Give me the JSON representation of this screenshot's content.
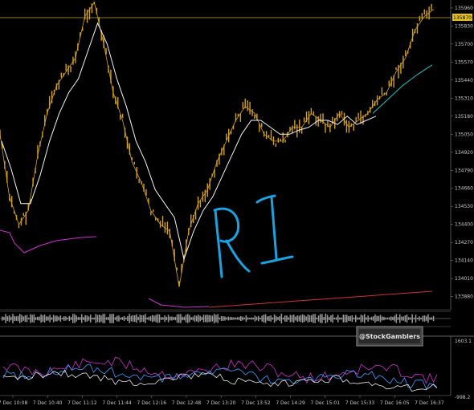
{
  "chart_data": {
    "type": "line",
    "price_axis": {
      "ticks": [
        "135960",
        "135830",
        "135700",
        "135570",
        "135440",
        "135310",
        "135180",
        "135050",
        "134920",
        "134790",
        "134660",
        "134530",
        "134400",
        "134270",
        "134140",
        "134010",
        "133880"
      ],
      "current_price_label": "135870",
      "ylim": [
        133820,
        136000
      ]
    },
    "x_axis": {
      "ticks": [
        "7 Dec 10:08",
        "7 Dec 10:40",
        "7 Dec 11:12",
        "7 Dec 11:44",
        "7 Dec 12:16",
        "7 Dec 12:48",
        "7 Dec 13:20",
        "7 Dec 13:52",
        "7 Dec 14:29",
        "7 Dec 15:01",
        "7 Dec 15:33",
        "7 Dec 16:05",
        "7 Dec 16:37"
      ]
    },
    "series": [
      {
        "name": "price",
        "color": "#d4a017",
        "values": [
          135050,
          134600,
          134400,
          134500,
          134900,
          135200,
          135400,
          135500,
          135600,
          135900,
          136000,
          135700,
          135350,
          135150,
          134850,
          134700,
          134500,
          134400,
          134350,
          133950,
          134350,
          134550,
          134650,
          134850,
          135000,
          135150,
          135250,
          135200,
          135050,
          135000,
          135000,
          135100,
          135100,
          135200,
          135150,
          135100,
          135200,
          135100,
          135150,
          135200,
          135300,
          135350,
          135500,
          135600,
          135800,
          135900,
          135950
        ]
      },
      {
        "name": "ma-white",
        "color": "#f2f2f2",
        "values": [
          135000,
          134800,
          134550,
          134550,
          134750,
          135000,
          135200,
          135350,
          135450,
          135650,
          135850,
          135700,
          135450,
          135250,
          135000,
          134850,
          134650,
          134550,
          134450,
          134150,
          134350,
          134500,
          134600,
          134750,
          134900,
          135050,
          135150,
          135150,
          135100,
          135050,
          135050,
          135080,
          135100,
          135150,
          135150,
          135120,
          135180,
          135120,
          135150,
          135180
        ]
      },
      {
        "name": "ma-cyan",
        "color": "#20c0c0",
        "values": [
          135200,
          135300,
          135400,
          135480,
          135550
        ]
      },
      {
        "name": "envelope-lower",
        "color": "#cc3333",
        "values": [
          134320,
          134250,
          134280,
          134300,
          134330,
          134350,
          134300,
          134260,
          134200,
          134100,
          133890,
          133870,
          133860,
          133860,
          133870,
          133880,
          133890,
          133900,
          133920,
          133950,
          133980,
          134010
        ]
      }
    ],
    "indicator": {
      "ticks": [
        "1603.1",
        "-998.2"
      ],
      "watermark": "@StockGamblers"
    },
    "annotation_text": "RI",
    "colors": {
      "background": "#000000",
      "candles": "#d4a017",
      "ma": "#f2f2f2",
      "envelope_lower": "#cc3333",
      "envelope_left": "#cc33cc",
      "annotation": "#1aa3e0",
      "current_price_bg": "#e8c21a"
    }
  }
}
